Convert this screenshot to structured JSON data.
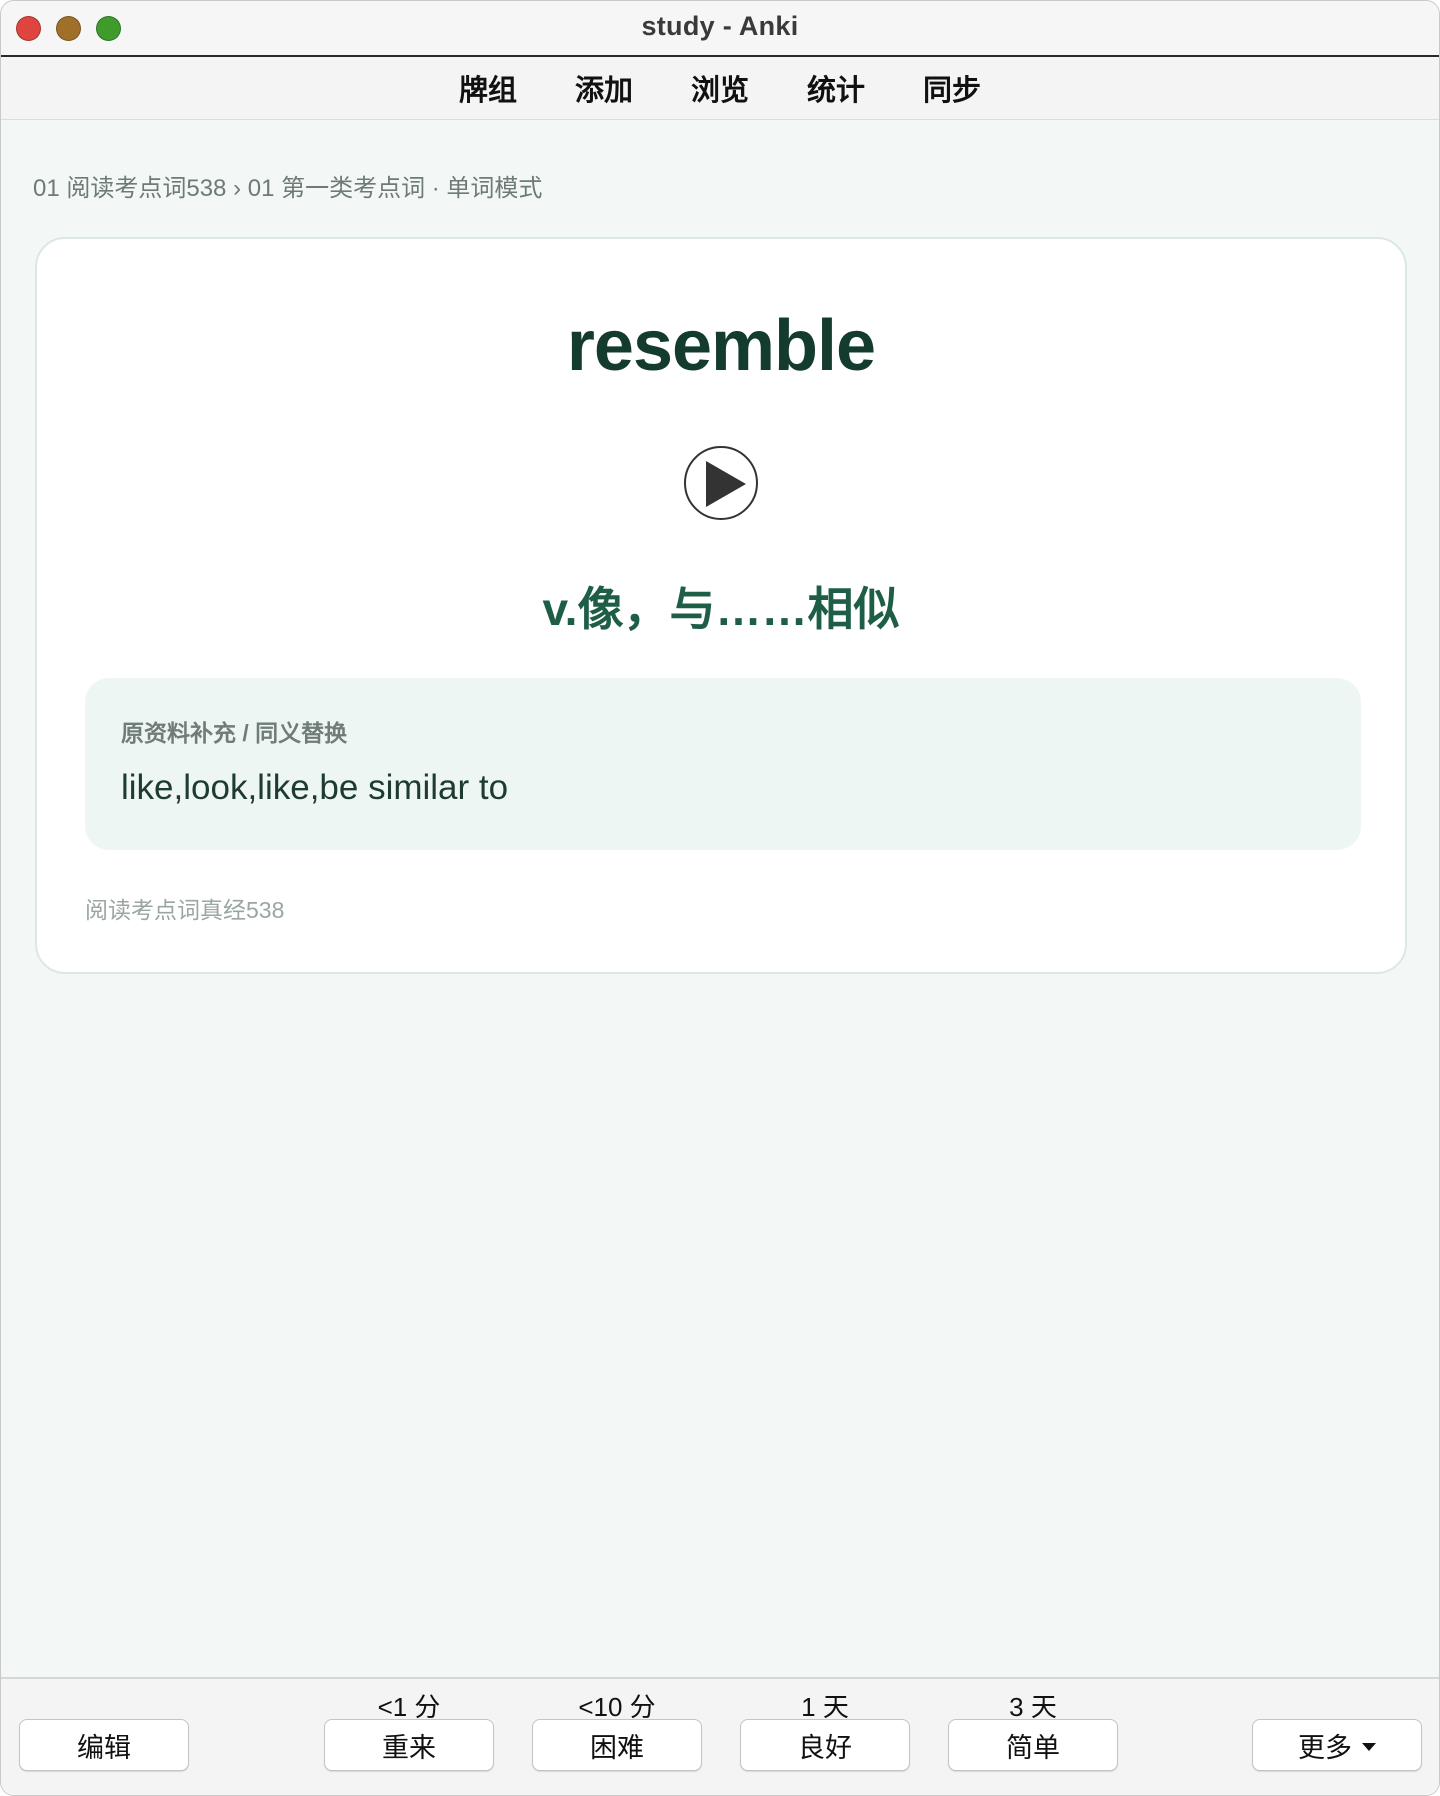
{
  "window": {
    "title": "study - Anki"
  },
  "topmenu": {
    "items": [
      {
        "label": "牌组"
      },
      {
        "label": "添加"
      },
      {
        "label": "浏览"
      },
      {
        "label": "统计"
      },
      {
        "label": "同步"
      }
    ]
  },
  "breadcrumb": "01 阅读考点词538 › 01 第一类考点词 · 单词模式",
  "card": {
    "word": "resemble",
    "play_icon": "play-icon",
    "meaning": "v.像，与……相似",
    "note_label": "原资料补充 / 同义替换",
    "note_text": "like,look,like,be similar to",
    "source": "阅读考点词真经538"
  },
  "bottombar": {
    "edit_label": "编辑",
    "more_label": "更多",
    "answers": [
      {
        "interval": "<1 分",
        "label": "重来"
      },
      {
        "interval": "<10 分",
        "label": "困难"
      },
      {
        "interval": "1 天",
        "label": "良好"
      },
      {
        "interval": "3 天",
        "label": "简单"
      }
    ]
  },
  "colors": {
    "background": "#f3f8f6",
    "word": "#143c2e",
    "meaning": "#1f5e46",
    "note_box": "#eef6f3"
  }
}
